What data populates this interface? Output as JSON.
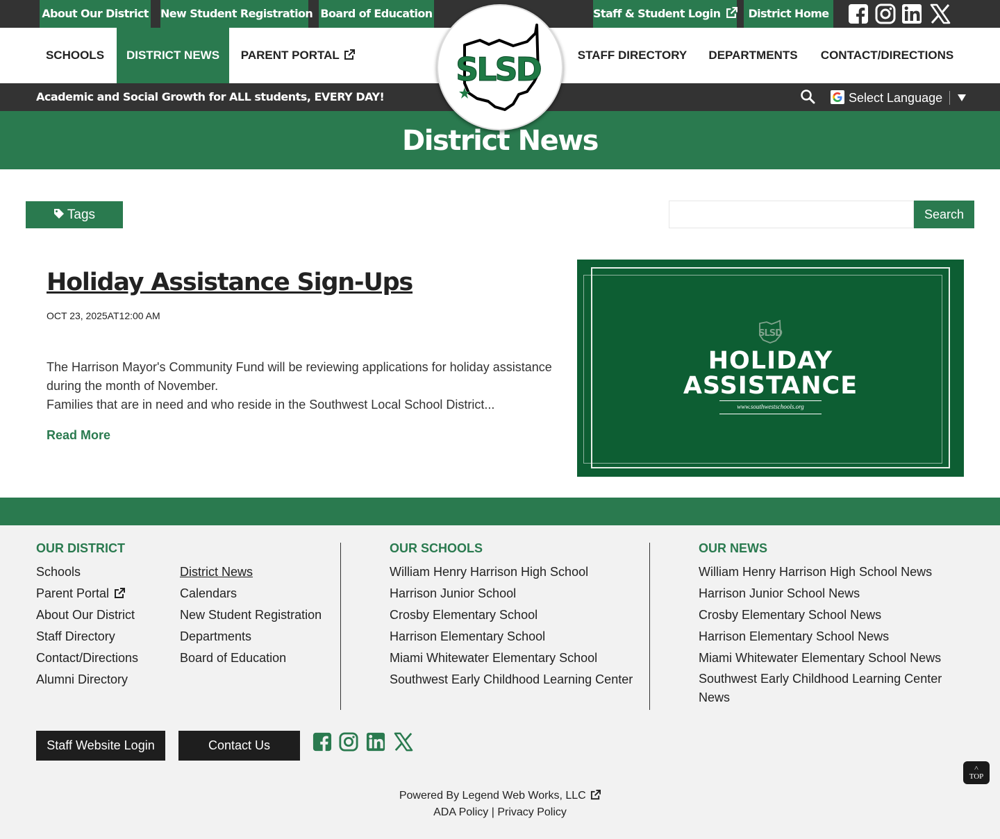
{
  "colors": {
    "brand_green": "#2a7a4f",
    "dark_bar": "#333333",
    "feature_green": "#0d5e33",
    "footer_bg": "#f2f2f2"
  },
  "topbar": {
    "links": [
      "About Our District",
      "New Student Registration",
      "Board of Education",
      "Staff & Student Login",
      "District Home"
    ],
    "social_icons": [
      "facebook-icon",
      "instagram-icon",
      "linkedin-icon",
      "x-icon"
    ]
  },
  "logo": {
    "text": "SLSD"
  },
  "nav": {
    "items": [
      "SCHOOLS",
      "DISTRICT NEWS",
      "PARENT PORTAL",
      "STAFF DIRECTORY",
      "DEPARTMENTS",
      "CONTACT/DIRECTIONS"
    ],
    "active": "DISTRICT NEWS"
  },
  "tagbar": {
    "tagline": "Academic and Social Growth for ALL students, EVERY DAY!",
    "language_label": "Select Language"
  },
  "banner": {
    "title": "District News"
  },
  "toolbar": {
    "tags_label": "Tags",
    "search_label": "Search",
    "search_value": ""
  },
  "article": {
    "title": "Holiday Assistance Sign-Ups",
    "date": "OCT 23, 2025AT12:00 AM",
    "body_lines": [
      "The Harrison Mayor's Community Fund will be reviewing applications for holiday assistance",
      "during the month of November.",
      "Families that are in need and who reside in the Southwest Local School District..."
    ],
    "read_more": "Read More",
    "image": {
      "logo_text": "SLSD",
      "line1": "HOLIDAY",
      "line2": "ASSISTANCE",
      "url": "www.southwestschools.org"
    }
  },
  "footer": {
    "district": {
      "heading": "OUR DISTRICT",
      "col1": [
        "Schools",
        "Parent Portal",
        "About Our District",
        "Staff Directory",
        "Contact/Directions",
        "Alumni Directory"
      ],
      "col2": [
        "District News",
        "Calendars",
        "New Student Registration",
        "Departments",
        "Board of Education"
      ]
    },
    "schools": {
      "heading": "OUR SCHOOLS",
      "items": [
        "William Henry Harrison High School",
        "Harrison Junior School",
        "Crosby Elementary School",
        "Harrison Elementary School",
        "Miami Whitewater Elementary School",
        "Southwest Early Childhood Learning Center"
      ]
    },
    "news": {
      "heading": "OUR NEWS",
      "items": [
        "William Henry Harrison High School News",
        "Harrison Junior School News",
        "Crosby Elementary School News",
        "Harrison Elementary School News",
        "Miami Whitewater Elementary School News"
      ],
      "last_item_line1": "Southwest Early Childhood Learning Center",
      "last_item_line2": "News"
    },
    "buttons": {
      "staff_login": "Staff Website Login",
      "contact": "Contact Us"
    },
    "powered_by": "Powered By Legend Web Works, LLC",
    "ada": "ADA Policy",
    "separator": "|",
    "privacy": "Privacy Policy",
    "top_arrow": "˄",
    "top_label": "TOP"
  }
}
